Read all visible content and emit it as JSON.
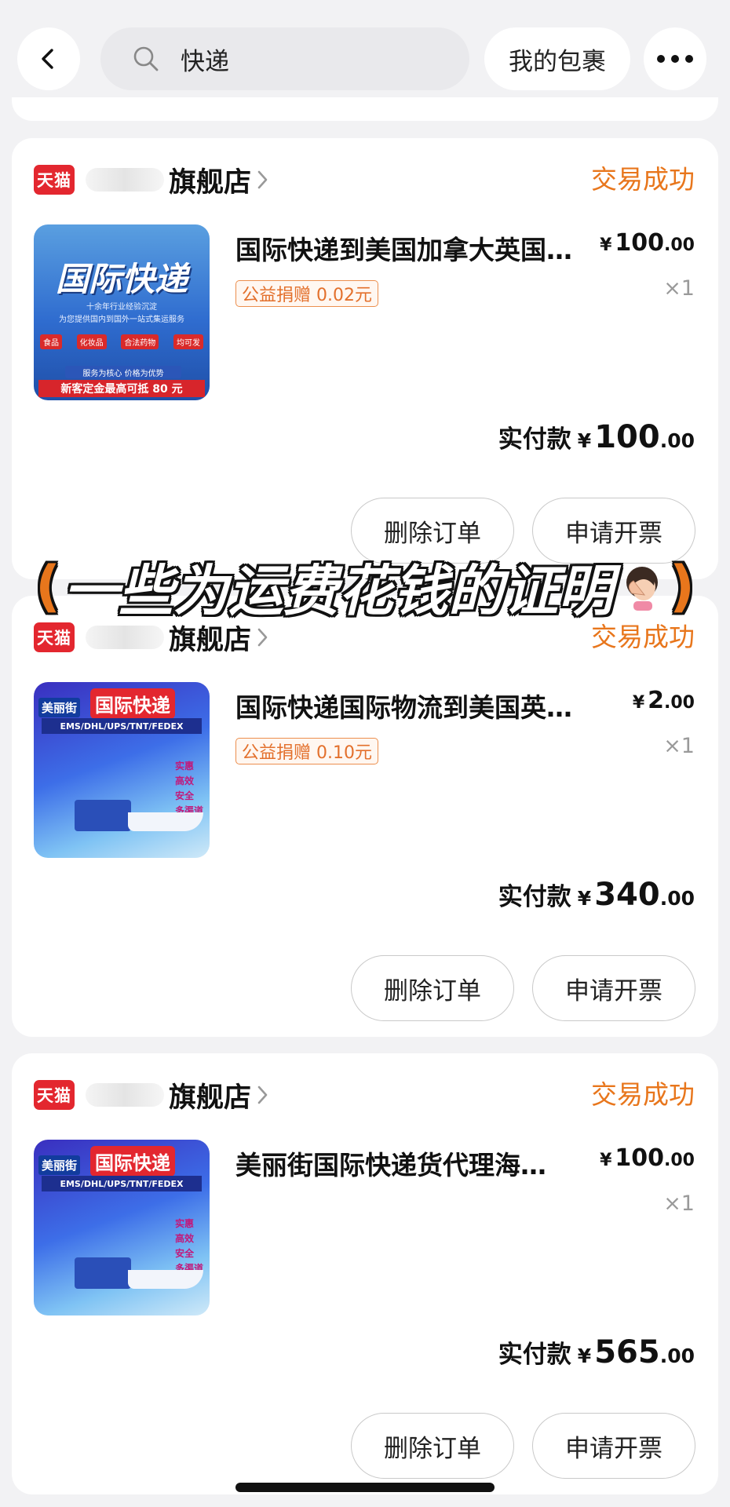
{
  "header": {
    "search_text": "快递",
    "parcel_button": "我的包裹"
  },
  "caption": {
    "open_paren": "(",
    "text": "一些为运费花钱的证明",
    "close_paren": ")"
  },
  "orders": [
    {
      "platform_badge": "天猫",
      "shop_name_suffix": "旗舰店",
      "status": "交易成功",
      "title": "国际快递到美国加拿大英国…",
      "unit_price_int": "100",
      "unit_price_dec": ".00",
      "donation": "公益捐赠 0.02元",
      "quantity": "×1",
      "paid_label": "实付款",
      "paid_int": "100",
      "paid_dec": ".00",
      "delete_button": "删除订单",
      "invoice_button": "申请开票",
      "thumb": {
        "title": "国际快递",
        "line1": "十余年行业经验沉淀",
        "line2": "为您提供国内到国外一站式集运服务",
        "tags": [
          "食品",
          "化妆品",
          "合法药物",
          "均可发"
        ],
        "bar_small": "服务为核心 价格为优势",
        "bar": "新客定金最高可抵 80 元"
      }
    },
    {
      "platform_badge": "天猫",
      "shop_name_suffix": "旗舰店",
      "status": "交易成功",
      "title": "国际快递国际物流到美国英…",
      "unit_price_int": "2",
      "unit_price_dec": ".00",
      "donation": "公益捐赠 0.10元",
      "quantity": "×1",
      "paid_label": "实付款",
      "paid_int": "340",
      "paid_dec": ".00",
      "delete_button": "删除订单",
      "invoice_button": "申请开票",
      "thumb": {
        "brand": "美丽街",
        "title": "国际快递",
        "carriers": "EMS/DHL/UPS/TNT/FEDEX",
        "checks": [
          "实惠",
          "高效",
          "安全",
          "多渠道"
        ]
      }
    },
    {
      "platform_badge": "天猫",
      "shop_name_suffix": "旗舰店",
      "status": "交易成功",
      "title": "美丽街国际快递货代理海…",
      "unit_price_int": "100",
      "unit_price_dec": ".00",
      "quantity": "×1",
      "paid_label": "实付款",
      "paid_int": "565",
      "paid_dec": ".00",
      "delete_button": "删除订单",
      "invoice_button": "申请开票",
      "thumb": {
        "brand": "美丽街",
        "title": "国际快递",
        "carriers": "EMS/DHL/UPS/TNT/FEDEX",
        "checks": [
          "实惠",
          "高效",
          "安全",
          "多渠道"
        ]
      }
    }
  ],
  "currency_symbol": "¥",
  "colors": {
    "accent_orange": "#e8761c",
    "tmall_red": "#e3272f",
    "background": "#f2f2f4"
  },
  "icons": [
    "back-arrow-icon",
    "search-icon",
    "more-dots-icon",
    "chevron-right-icon",
    "facepalm-emoji-icon"
  ]
}
